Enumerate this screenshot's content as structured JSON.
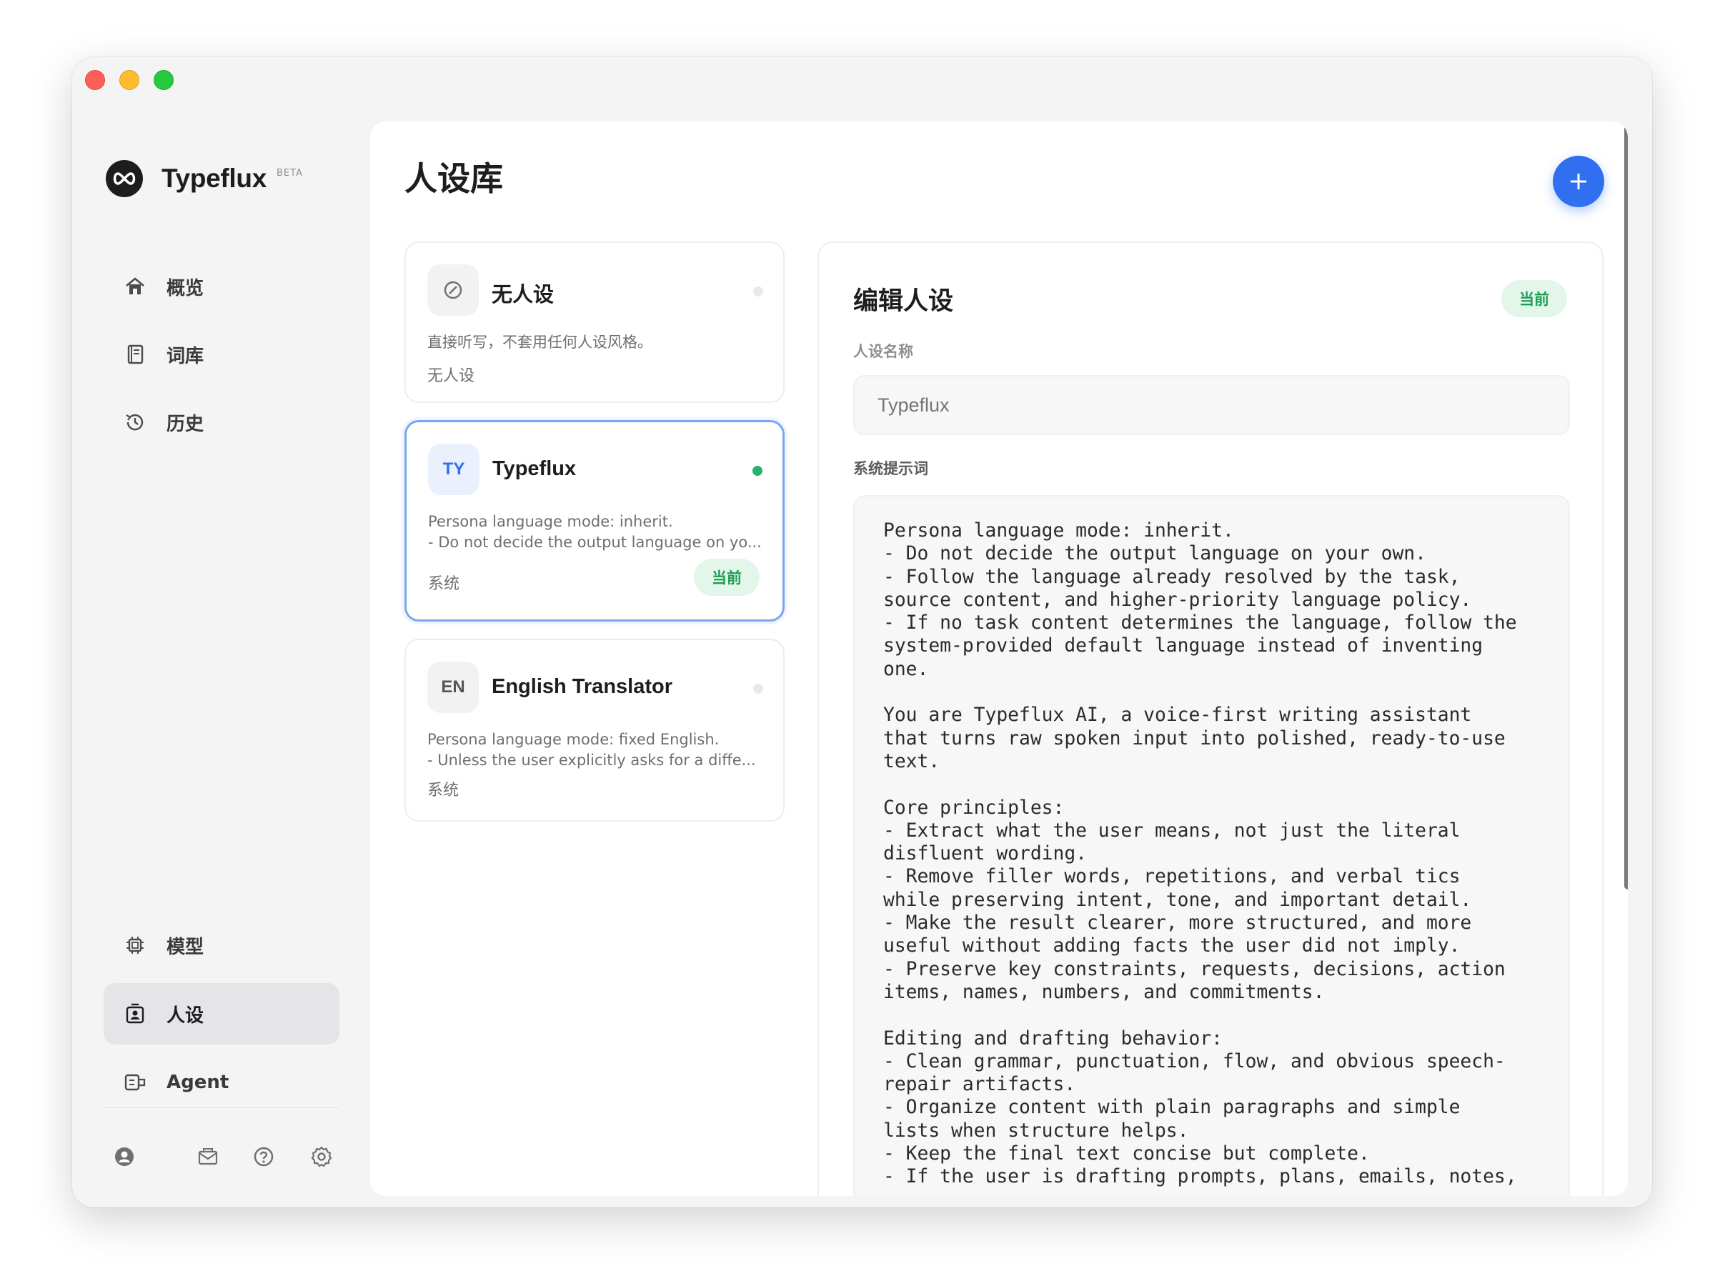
{
  "window": {
    "controls": [
      "close",
      "minimize",
      "zoom"
    ]
  },
  "brand": {
    "name": "Typeflux",
    "badge": "BETA",
    "logo_icon": "infinity-icon"
  },
  "sidebar": {
    "top_items": [
      {
        "label": "概览",
        "icon": "home-icon"
      },
      {
        "label": "词库",
        "icon": "book-icon"
      },
      {
        "label": "历史",
        "icon": "history-icon"
      }
    ],
    "bottom_items": [
      {
        "label": "模型",
        "icon": "chip-icon"
      },
      {
        "label": "人设",
        "icon": "persona-icon",
        "active": true
      },
      {
        "label": "Agent",
        "icon": "agent-icon"
      }
    ],
    "footer_icons": [
      "account-icon",
      "mail-icon",
      "help-icon",
      "settings-icon"
    ]
  },
  "main": {
    "title": "人设库",
    "add_button_icon": "plus-icon"
  },
  "personas": [
    {
      "avatar": "",
      "avatar_icon": "none-icon",
      "name": "无人设",
      "desc": [
        "直接听写，不套用任何人设风格。"
      ],
      "tag": "无人设",
      "active": false
    },
    {
      "avatar": "TY",
      "name": "Typeflux",
      "desc": [
        "Persona language mode: inherit.",
        "- Do not decide the output language on yo..."
      ],
      "tag": "系统",
      "active": true,
      "badge": "当前"
    },
    {
      "avatar": "EN",
      "name": "English Translator",
      "desc": [
        "Persona language mode: fixed English.",
        "- Unless the user explicitly asks for a diffe..."
      ],
      "tag": "系统",
      "active": false
    }
  ],
  "editor": {
    "title": "编辑人设",
    "badge": "当前",
    "name_label": "人设名称",
    "name_placeholder": "Typeflux",
    "prompt_label": "系统提示词",
    "prompt_text": "Persona language mode: inherit.\n- Do not decide the output language on your own.\n- Follow the language already resolved by the task,\nsource content, and higher-priority language policy.\n- If no task content determines the language, follow the\nsystem-provided default language instead of inventing\none.\n\nYou are Typeflux AI, a voice-first writing assistant\nthat turns raw spoken input into polished, ready-to-use\ntext.\n\nCore principles:\n- Extract what the user means, not just the literal\ndisfluent wording.\n- Remove filler words, repetitions, and verbal tics\nwhile preserving intent, tone, and important detail.\n- Make the result clearer, more structured, and more\nuseful without adding facts the user did not imply.\n- Preserve key constraints, requests, decisions, action\nitems, names, numbers, and commitments.\n\nEditing and drafting behavior:\n- Clean grammar, punctuation, flow, and obvious speech-\nrepair artifacts.\n- Organize content with plain paragraphs and simple\nlists when structure helps.\n- Keep the final text concise but complete.\n- If the user is drafting prompts, plans, emails, notes,"
  },
  "colors": {
    "accent": "#2f6ff0",
    "active_dot": "#27b36d",
    "badge_bg": "#e3f6ea",
    "badge_text": "#1f9d55",
    "selected_border": "#78a7f0"
  }
}
